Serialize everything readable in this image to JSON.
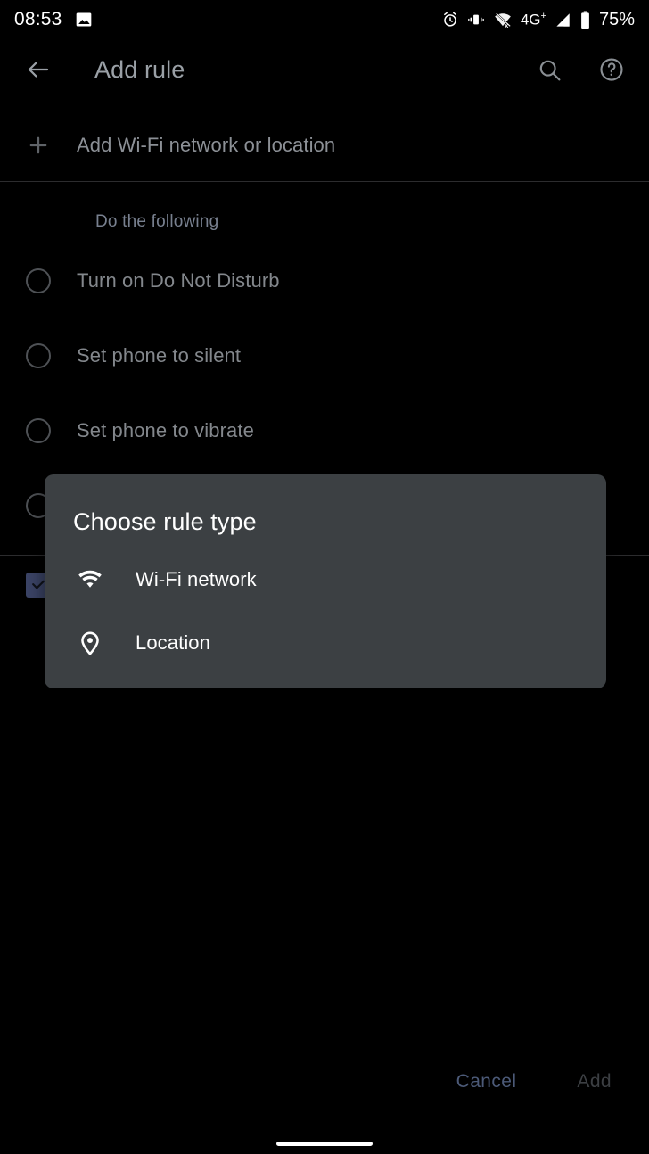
{
  "status_bar": {
    "time": "08:53",
    "icons_left": [
      "image-icon"
    ],
    "icons_right": [
      "alarm-icon",
      "vibrate-icon",
      "wifi-off-icon",
      "signal-icon",
      "battery-icon"
    ],
    "network_label": "4G",
    "network_superscript": "+",
    "battery_percent": "75%"
  },
  "toolbar": {
    "back_icon": "arrow-back-icon",
    "title": "Add rule",
    "search_icon": "search-icon",
    "help_icon": "help-circle-icon"
  },
  "add_row": {
    "icon": "plus-icon",
    "label": "Add Wi-Fi network or location"
  },
  "section": {
    "header": "Do the following",
    "options": [
      {
        "label": "Turn on Do Not Disturb",
        "selected": false
      },
      {
        "label": "Set phone to silent",
        "selected": false
      },
      {
        "label": "Set phone to vibrate",
        "selected": false
      }
    ]
  },
  "checkbox_row": {
    "icon": "check-icon",
    "checked": true,
    "accent_color": "#3b4466"
  },
  "dialog": {
    "title": "Choose rule type",
    "background_color": "#3c4043",
    "items": [
      {
        "icon": "wifi-icon",
        "label": "Wi-Fi network"
      },
      {
        "icon": "location-pin-icon",
        "label": "Location"
      }
    ]
  },
  "footer": {
    "cancel_label": "Cancel",
    "add_label": "Add"
  },
  "navigation": {
    "gesture_bar": "home-gesture-bar"
  }
}
